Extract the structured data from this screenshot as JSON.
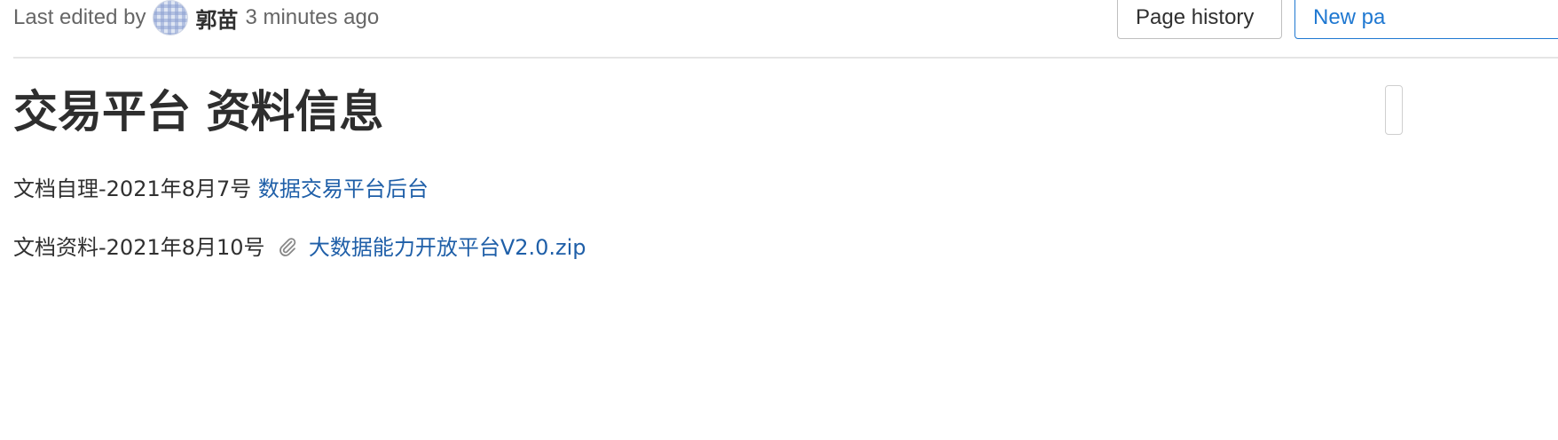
{
  "header": {
    "last_edited_prefix": "Last edited by",
    "author": "郭苗",
    "time_ago": "3 minutes ago",
    "page_history_label": "Page history",
    "new_page_label": "New pa"
  },
  "page": {
    "title": "交易平台 资料信息",
    "lines": [
      {
        "prefix": "文档自理-2021年8月7号",
        "link_text": "数据交易平台后台"
      },
      {
        "prefix": "文档资料-2021年8月10号",
        "attachment_icon": "paperclip-icon",
        "link_text": "大数据能力开放平台V2.0.zip"
      }
    ]
  },
  "colors": {
    "link": "#1f5fa8",
    "primary_button": "#1f78d1",
    "divider": "#e5e5e5"
  }
}
